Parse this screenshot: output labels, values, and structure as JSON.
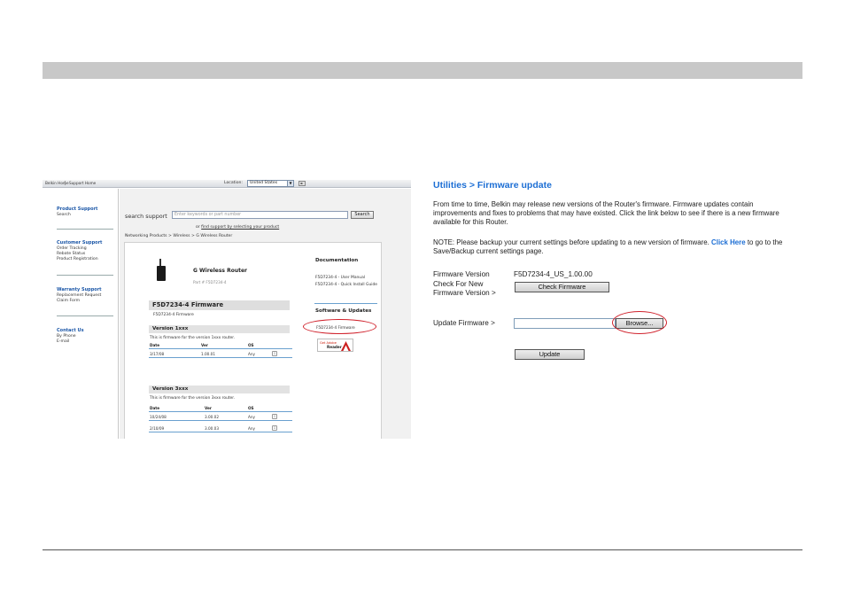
{
  "support_page": {
    "topnav": {
      "links": [
        "Belkin Home",
        "Support Home"
      ],
      "location_label": "Location:",
      "location_value": "United States",
      "dropdown_arrow": "▼",
      "go_arrow": "►"
    },
    "sidebar": [
      {
        "title": "Product Support",
        "items": [
          "Search"
        ]
      },
      {
        "title": "Customer Support",
        "items": [
          "Order Tracking",
          "Rebate Status",
          "Product Registration"
        ]
      },
      {
        "title": "Warranty Support",
        "items": [
          "Replacement Request",
          "Claim Form"
        ]
      },
      {
        "title": "Contact Us",
        "items": [
          "By Phone",
          "E-mail"
        ]
      }
    ],
    "search": {
      "label": "search support",
      "placeholder": "Enter keywords or part number",
      "button": "Search",
      "or_text": "or",
      "find_link": "find support by selecting your product"
    },
    "breadcrumb": "Networking Products > Wireless > G Wireless Router",
    "product": {
      "name": "G Wireless Router",
      "part": "Part # F5D7234-4"
    },
    "firmware": {
      "heading": "F5D7234-4 Firmware",
      "subtitle": "F5D7234-4 Firmware",
      "versions": [
        {
          "title": "Version 1xxx",
          "desc": "This is firmware for the version 1xxx router.",
          "headers": [
            "Date",
            "Ver",
            "OS"
          ],
          "rows": [
            {
              "date": "3/17/08",
              "ver": "1.00.01",
              "os": "Any"
            }
          ]
        },
        {
          "title": "Version 3xxx",
          "desc": "This is firmware for the version 3xxx router.",
          "headers": [
            "Date",
            "Ver",
            "OS"
          ],
          "rows": [
            {
              "date": "10/24/08",
              "ver": "3.00.02",
              "os": "Any"
            },
            {
              "date": "2/10/09",
              "ver": "3.00.03",
              "os": "Any"
            }
          ]
        }
      ],
      "download_icon": "⇩"
    },
    "documentation": {
      "title": "Documentation",
      "links": [
        "F5D7234-4 - User Manual",
        "F5D7234-4 - Quick Install Guide"
      ]
    },
    "software": {
      "title": "Software & Updates",
      "link": "F5D7234-4 Firmware"
    },
    "adobe": {
      "get": "Get Adobe",
      "name": "Reader"
    }
  },
  "firmware_page": {
    "title": "Utilities > Firmware update",
    "intro": "From time to time, Belkin may release new versions of the Router's firmware. Firmware updates contain improvements and fixes to problems that may have existed. Click the link below to see if there is a new firmware available for this Router.",
    "note_prefix": "NOTE: Please backup your current settings before updating to a new version of firmware.",
    "note_link": "Click Here",
    "note_suffix": "to go to the Save/Backup current settings page.",
    "firmware_version_label": "Firmware Version",
    "firmware_version_value": "F5D7234-4_US_1.00.00",
    "check_label": "Check For New Firmware Version >",
    "check_button": "Check Firmware",
    "update_label": "Update Firmware >",
    "browse_button": "Browse...",
    "update_button": "Update"
  },
  "colors": {
    "accent_blue": "#1c6ed4",
    "highlight_red": "#d0202a",
    "header_gray": "#c8c8c8"
  }
}
